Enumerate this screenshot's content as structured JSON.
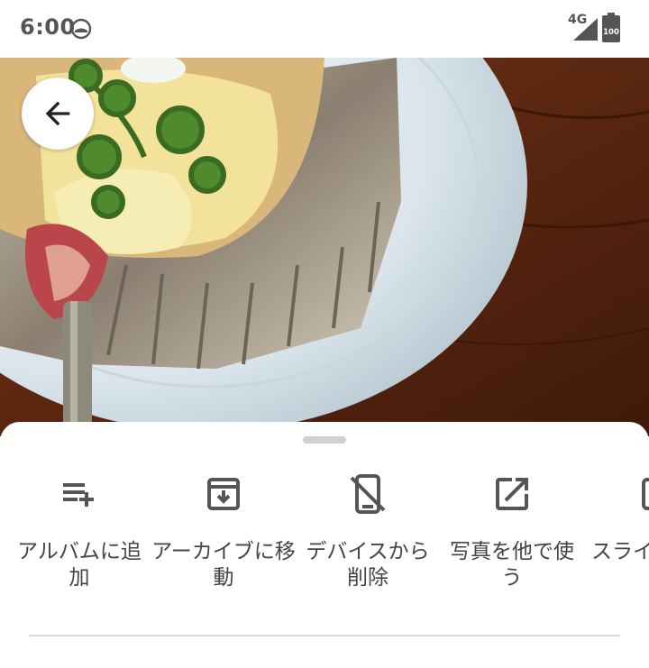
{
  "status_bar": {
    "time": "6:00",
    "network": "4G",
    "battery": "100",
    "icons": [
      "do-not-disturb-icon",
      "cellular-signal-icon",
      "battery-icon"
    ]
  },
  "viewer": {
    "back_icon": "arrow-back-icon",
    "photo_description": "cake-on-plate-photo"
  },
  "actions": [
    {
      "label": "アルバムに追加",
      "icon": "playlist-add-icon"
    },
    {
      "label": "アーカイブに移動",
      "icon": "archive-icon"
    },
    {
      "label": "デバイスから削除",
      "icon": "delete-from-device-icon"
    },
    {
      "label": "写真を他で使う",
      "icon": "open-in-new-icon"
    },
    {
      "label": "スライ",
      "icon": "slideshow-icon"
    }
  ],
  "colors": {
    "icon": "#555555",
    "label": "#444444",
    "handle": "#d0d0d0",
    "wood": "#5b2a12",
    "plate": "#dfe8ee"
  }
}
